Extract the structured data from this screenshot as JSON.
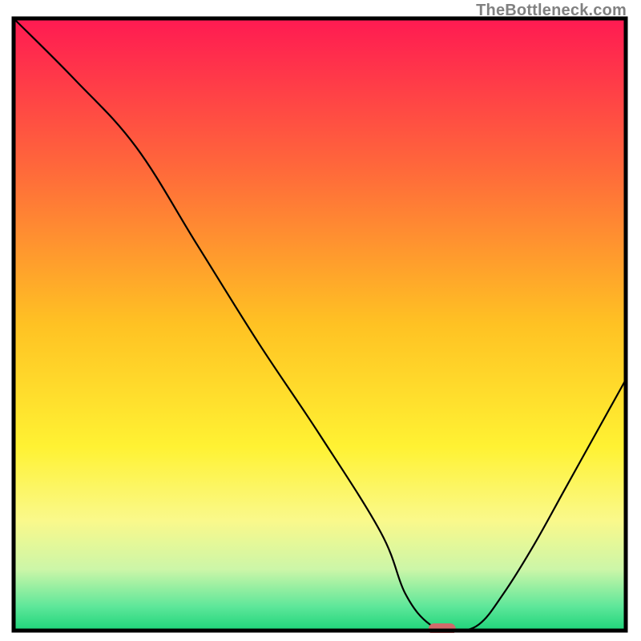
{
  "watermark": "TheBottleneck.com",
  "chart_data": {
    "type": "line",
    "title": "",
    "xlabel": "",
    "ylabel": "",
    "xlim": [
      0,
      100
    ],
    "ylim": [
      0,
      100
    ],
    "grid": false,
    "legend": false,
    "x": [
      0,
      10,
      20,
      30,
      40,
      50,
      60,
      64,
      68,
      72,
      76,
      80,
      85,
      90,
      95,
      100
    ],
    "values": [
      100,
      90,
      79,
      63,
      47,
      32,
      16,
      6,
      1,
      0,
      1,
      6,
      14,
      23,
      32,
      41
    ],
    "gradient_stops": [
      {
        "offset": 0.0,
        "color": "#ff1a52"
      },
      {
        "offset": 0.25,
        "color": "#ff6a3a"
      },
      {
        "offset": 0.5,
        "color": "#ffc223"
      },
      {
        "offset": 0.7,
        "color": "#fff233"
      },
      {
        "offset": 0.82,
        "color": "#faf98b"
      },
      {
        "offset": 0.9,
        "color": "#ccf6a8"
      },
      {
        "offset": 0.96,
        "color": "#5fe79a"
      },
      {
        "offset": 1.0,
        "color": "#1ed47a"
      }
    ],
    "marker": {
      "x": 70,
      "y": 0,
      "color": "#d06a6a"
    },
    "annotations": []
  }
}
